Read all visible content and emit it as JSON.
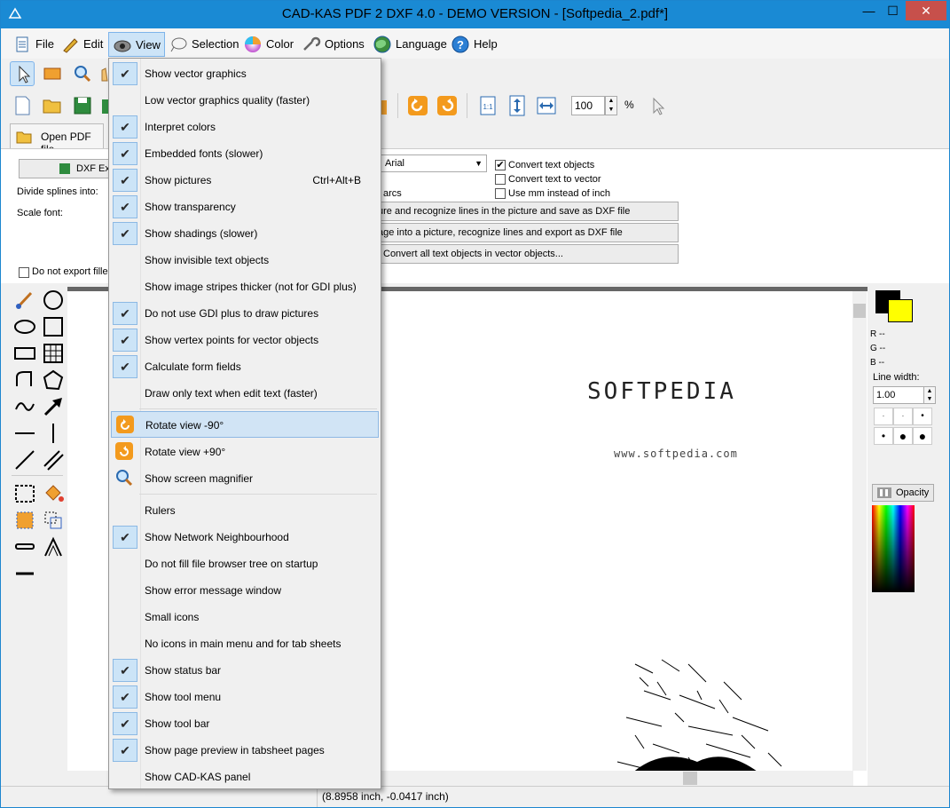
{
  "window": {
    "title": "CAD-KAS PDF 2 DXF 4.0 - DEMO VERSION - [Softpedia_2.pdf*]",
    "minimize": "—",
    "maximize": "☐",
    "close": "✕"
  },
  "menubar": {
    "items": [
      {
        "label": "File",
        "icon": "file-icon"
      },
      {
        "label": "Edit",
        "icon": "edit-icon"
      },
      {
        "label": "View",
        "icon": "view-icon"
      },
      {
        "label": "Selection",
        "icon": "selection-icon"
      },
      {
        "label": "Color",
        "icon": "color-icon"
      },
      {
        "label": "Options",
        "icon": "options-icon"
      },
      {
        "label": "Language",
        "icon": "language-icon"
      },
      {
        "label": "Help",
        "icon": "help-icon"
      }
    ]
  },
  "toolbar": {
    "open_pdf": "Open PDF file",
    "zoom_value": "100",
    "zoom_unit": "%",
    "ratio_label": "1:1"
  },
  "options_panel": {
    "dxf_button": "DXF Exp",
    "divide_splines": "Divide splines into:",
    "scale_font": "Scale font:",
    "font_select": "Arial",
    "arcs_label": "arcs",
    "do_not_export": "Do not export fille",
    "convert_text_objects": "Convert text objects",
    "convert_text_to_vector": "Convert text to vector",
    "use_mm": "Use mm instead of inch",
    "btn_recognize_save": "ure and recognize lines in the picture and save as DXF file",
    "btn_recognize_export": "age into a picture, recognize lines and export as DXF file",
    "btn_convert_text": "Convert all text objects in vector objects..."
  },
  "view_menu": {
    "items": [
      {
        "label": "Show vector graphics",
        "checked": true
      },
      {
        "label": "Low vector graphics quality (faster)",
        "checked": false
      },
      {
        "label": "Interpret colors",
        "checked": true
      },
      {
        "label": "Embedded fonts (slower)",
        "checked": true
      },
      {
        "label": "Show pictures",
        "checked": true,
        "shortcut": "Ctrl+Alt+B"
      },
      {
        "label": "Show transparency",
        "checked": true
      },
      {
        "label": "Show shadings (slower)",
        "checked": true
      },
      {
        "label": "Show invisible text objects",
        "checked": false
      },
      {
        "label": "Show image stripes thicker (not for GDI plus)",
        "checked": false
      },
      {
        "label": "Do not use GDI plus to draw pictures",
        "checked": true
      },
      {
        "label": "Show vertex points for vector objects",
        "checked": true
      },
      {
        "label": "Calculate form fields",
        "checked": true
      },
      {
        "label": "Draw only text when edit text  (faster)",
        "checked": false
      }
    ],
    "rotate_items": [
      {
        "label": "Rotate view -90°",
        "icon": "rotate-left-icon"
      },
      {
        "label": "Rotate view +90°",
        "icon": "rotate-right-icon"
      },
      {
        "label": "Show screen magnifier",
        "icon": "magnifier-icon"
      }
    ],
    "more_items": [
      {
        "label": "Rulers",
        "checked": false
      },
      {
        "label": "Show Network Neighbourhood",
        "checked": true
      },
      {
        "label": "Do not fill file browser tree on startup",
        "checked": false
      },
      {
        "label": "Show error message window",
        "checked": false
      },
      {
        "label": "Small icons",
        "checked": false
      },
      {
        "label": "No icons in main menu and for tab sheets",
        "checked": false
      },
      {
        "label": "Show status bar",
        "checked": true
      },
      {
        "label": "Show tool menu",
        "checked": true
      },
      {
        "label": "Show tool bar",
        "checked": true
      },
      {
        "label": "Show page preview in tabsheet pages",
        "checked": true
      },
      {
        "label": "Show CAD-KAS panel",
        "checked": false
      }
    ]
  },
  "right_panel": {
    "r_label": "R --",
    "g_label": "G --",
    "b_label": "B --",
    "line_width_label": "Line width:",
    "line_width_value": "1.00",
    "opacity_button": "Opacity"
  },
  "canvas": {
    "softpedia_text": "SOFTPEDIA",
    "url_text": "www.softpedia.com"
  },
  "statusbar": {
    "coords": "(8.8958 inch, -0.0417 inch)"
  },
  "colors": {
    "accent": "#1a8ad4",
    "menu_highlight": "#d1e4f5",
    "check_bg": "#cce4f7",
    "fill_color": "#ffff00",
    "stroke_color": "#000000"
  }
}
